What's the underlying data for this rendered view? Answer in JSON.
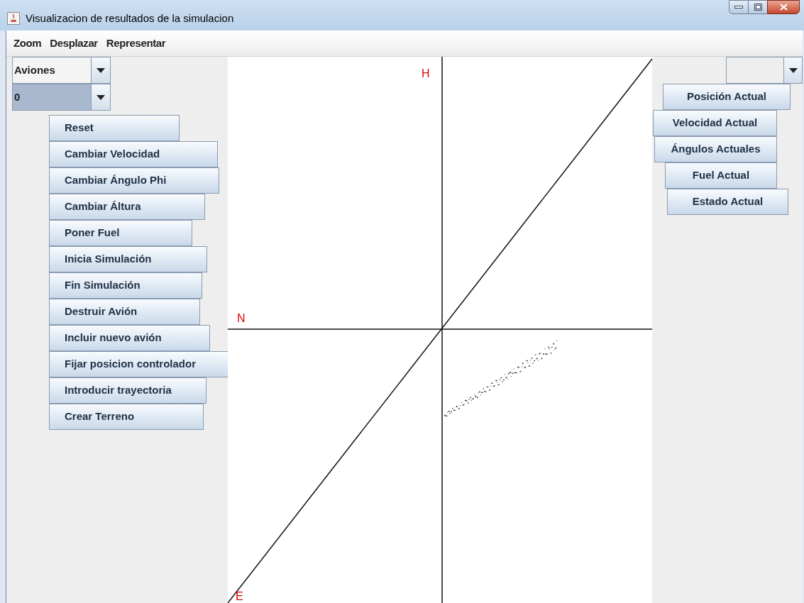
{
  "window": {
    "title": "Visualizacion de resultados de la simulacion"
  },
  "menu": [
    "Zoom",
    "Desplazar",
    "Representar"
  ],
  "left_dropdowns": [
    {
      "value": "Aviones",
      "selected": false
    },
    {
      "value": "0",
      "selected": true
    }
  ],
  "left_buttons": [
    "Reset",
    "Cambiar Velocidad",
    "Cambiar Ángulo Phi",
    "Cambiar Áltura",
    "Poner Fuel",
    "Inicia Simulación",
    "Fin Simulación",
    "Destruir Avión",
    "Incluir nuevo avión",
    "Fijar posicion controlador",
    "Introducir trayectoria",
    "Crear Terreno"
  ],
  "plot": {
    "axis_labels": [
      "H",
      "N",
      "E"
    ]
  },
  "right_buttons": [
    "Posición Actual",
    "Velocidad Actual",
    "Ángulos Actuales",
    "Fuel Actual",
    "Estado Actual"
  ]
}
